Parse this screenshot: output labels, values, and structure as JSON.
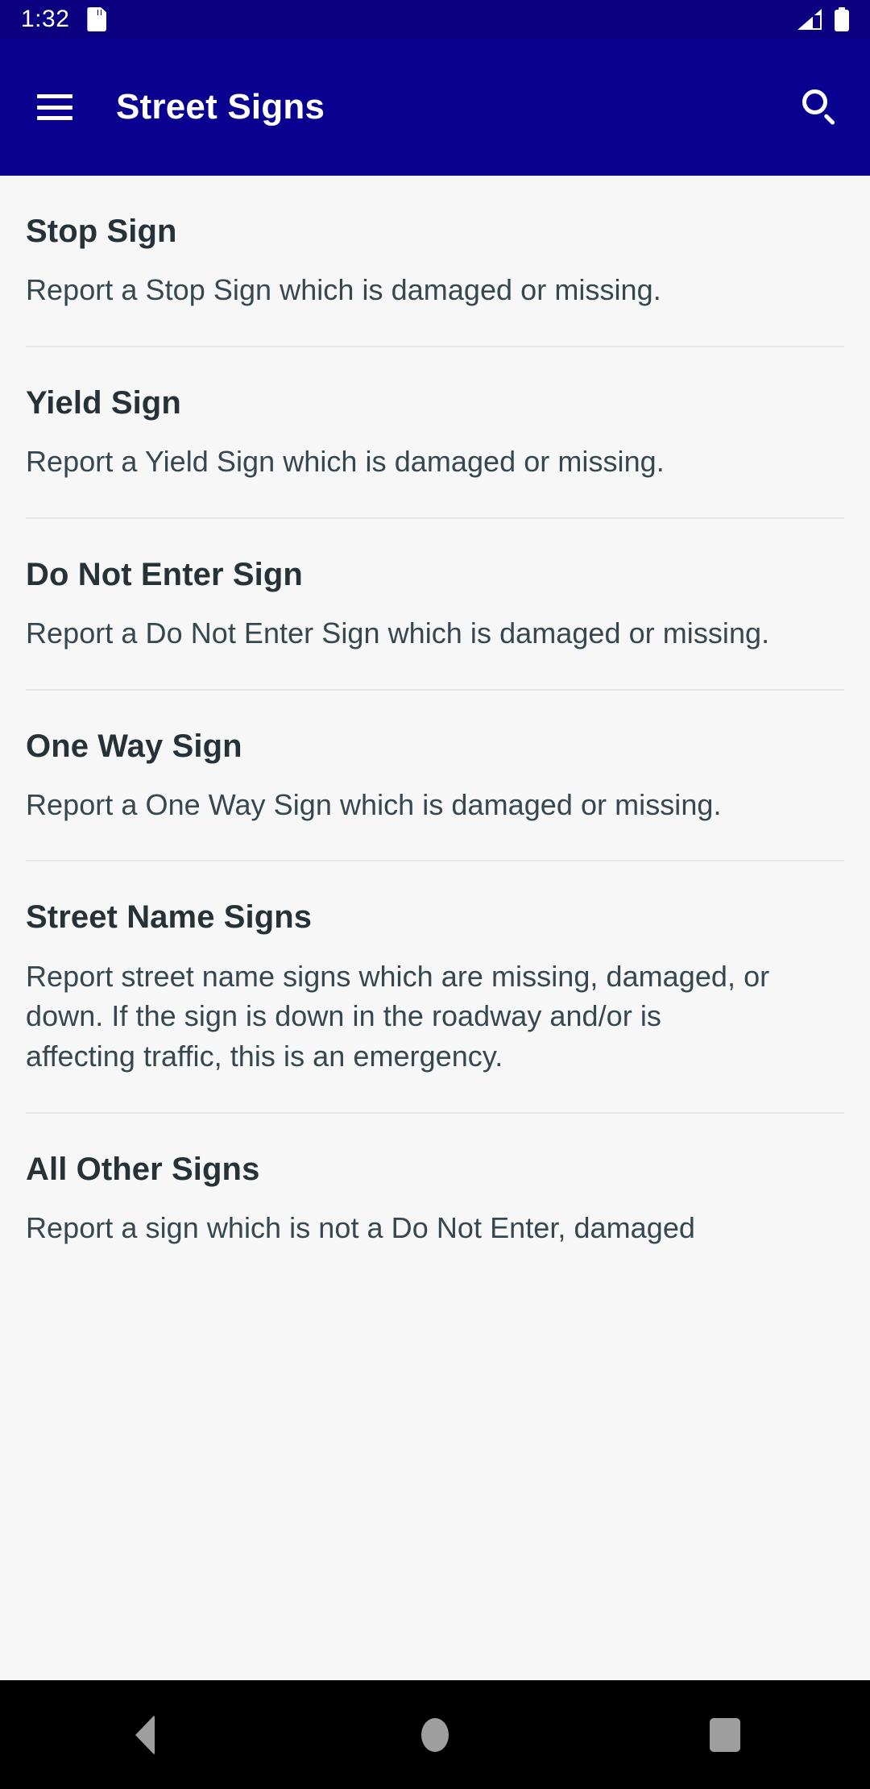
{
  "status_bar": {
    "time": "1:32",
    "icons": [
      "sd-card-icon",
      "wifi-icon",
      "cellular-signal-icon",
      "battery-icon"
    ],
    "background_color": "#0a0080"
  },
  "app_bar": {
    "menu_icon": "hamburger-menu-icon",
    "title": "Street Signs",
    "search_icon": "search-icon",
    "background_color": "#0a0090",
    "text_color": "#ffffff"
  },
  "list": {
    "items": [
      {
        "title": "Stop Sign",
        "description": "Report a Stop Sign which is damaged or missing."
      },
      {
        "title": "Yield Sign",
        "description": "Report a Yield Sign which is damaged or missing."
      },
      {
        "title": "Do Not Enter Sign",
        "description": "Report a Do Not Enter Sign which is damaged or missing."
      },
      {
        "title": "One Way Sign",
        "description": "Report a One Way Sign which is damaged or missing."
      },
      {
        "title": "Street Name Signs",
        "description": "Report street name signs which are missing, damaged, or down. If the sign is down in the roadway and/or is affecting traffic, this is an emergency."
      },
      {
        "title": "All Other Signs",
        "description": "Report a sign which is not a Do Not Enter, damaged"
      }
    ]
  },
  "nav_bar": {
    "back_label": "back-button",
    "home_label": "home-button",
    "recents_label": "recents-button",
    "background_color": "#000000"
  }
}
